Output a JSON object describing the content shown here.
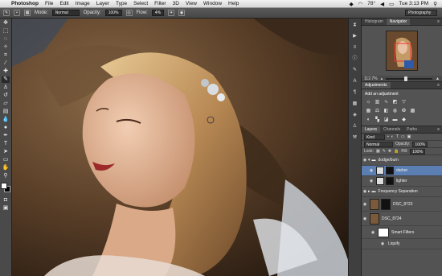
{
  "menubar": {
    "app": "Photoshop",
    "items": [
      "File",
      "Edit",
      "Image",
      "Layer",
      "Type",
      "Select",
      "Filter",
      "3D",
      "View",
      "Window",
      "Help"
    ],
    "status": {
      "temperature": "78°",
      "clock": "Tue 3:13 PM"
    }
  },
  "options": {
    "mode_label": "Mode:",
    "mode_value": "Normal",
    "opacity_label": "Opacity:",
    "opacity_value": "100%",
    "flow_label": "Flow:",
    "flow_value": "4%",
    "workspace": "Photography"
  },
  "navigator": {
    "tabs": [
      "Histogram",
      "Navigator"
    ],
    "active_tab": "Navigator",
    "zoom": "112.7%"
  },
  "adjustments": {
    "tab": "Adjustments",
    "title": "Add an adjustment"
  },
  "layers": {
    "tabs": [
      "Layers",
      "Channels",
      "Paths"
    ],
    "kind_filter": "Kind",
    "blend_mode": "Normal",
    "opacity_label": "Opacity:",
    "opacity_value": "100%",
    "lock_label": "Lock:",
    "fill_label": "Fill:",
    "fill_value": "100%",
    "items": [
      {
        "name": "dodge/burn",
        "type": "group"
      },
      {
        "name": "darker",
        "type": "adjustment"
      },
      {
        "name": "lighter",
        "type": "adjustment"
      },
      {
        "name": "Frequency Separation",
        "type": "group"
      },
      {
        "name": "DSC_8723",
        "type": "layer"
      },
      {
        "name": "DSC_8724",
        "type": "smart"
      },
      {
        "name": "Smart Filters",
        "type": "filter"
      },
      {
        "name": "Liquify",
        "type": "filter-item"
      }
    ]
  },
  "colors": {
    "selected_layer": "#5c7fb3",
    "panel": "#535353",
    "toolbar": "#4a4a4a"
  }
}
